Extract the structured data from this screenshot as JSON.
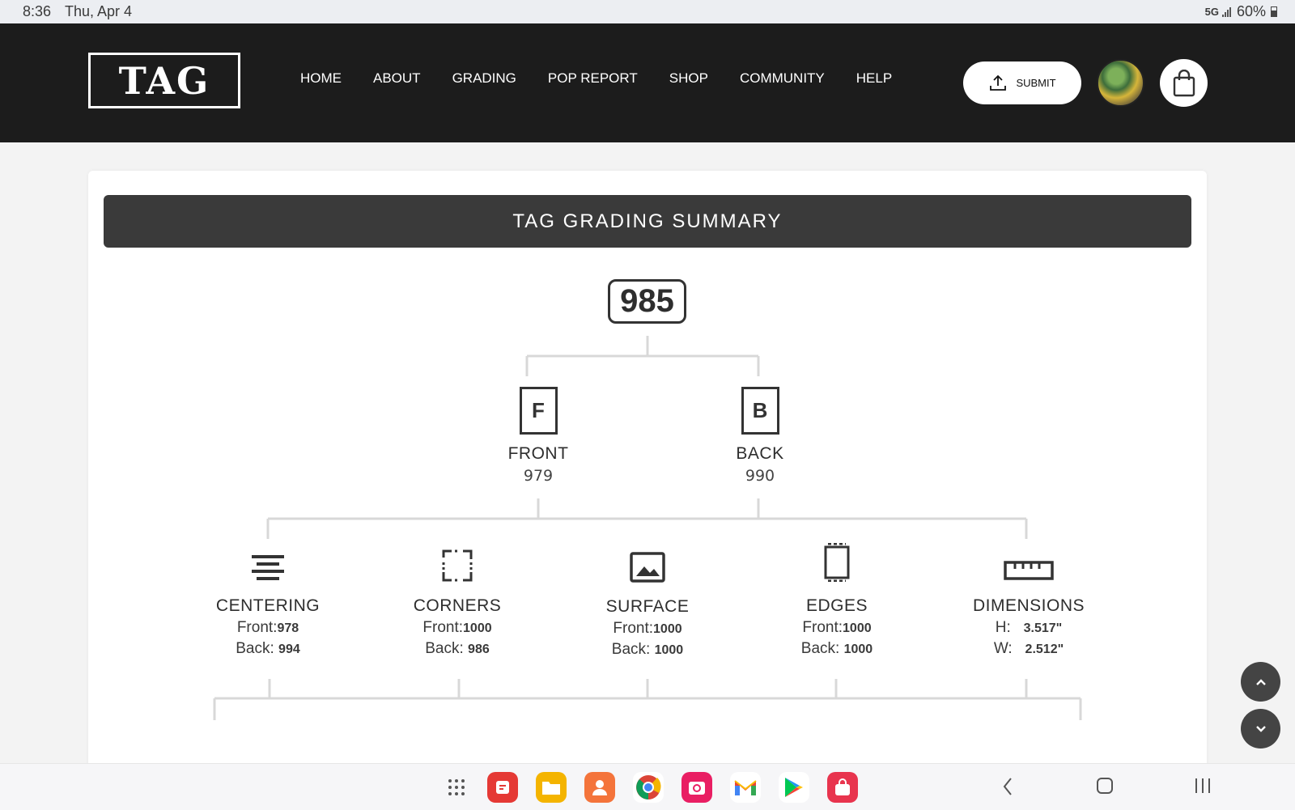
{
  "status": {
    "time": "8:36",
    "date": "Thu, Apr 4",
    "network": "5G",
    "battery": "60%"
  },
  "header": {
    "logo": "TAG",
    "nav": [
      "HOME",
      "ABOUT",
      "GRADING",
      "POP REPORT",
      "SHOP",
      "COMMUNITY",
      "HELP"
    ],
    "submit_label": "SUBMIT",
    "icons": {
      "submit": "upload-icon",
      "cart": "shopping-bag-icon"
    }
  },
  "summary": {
    "title": "TAG GRADING SUMMARY",
    "overall_score": "985",
    "front": {
      "letter": "F",
      "label": "FRONT",
      "value": "979"
    },
    "back": {
      "letter": "B",
      "label": "BACK",
      "value": "990"
    },
    "metrics": [
      {
        "label": "CENTERING",
        "row1_label": "Front:",
        "row1_value": "978",
        "row2_label": "Back:",
        "row2_value": "994",
        "icon": "centering-icon"
      },
      {
        "label": "CORNERS",
        "row1_label": "Front:",
        "row1_value": "1000",
        "row2_label": "Back:",
        "row2_value": "986",
        "icon": "corners-icon"
      },
      {
        "label": "SURFACE",
        "row1_label": "Front:",
        "row1_value": "1000",
        "row2_label": "Back:",
        "row2_value": "1000",
        "icon": "surface-icon"
      },
      {
        "label": "EDGES",
        "row1_label": "Front:",
        "row1_value": "1000",
        "row2_label": "Back:",
        "row2_value": "1000",
        "icon": "edges-icon"
      },
      {
        "label": "DIMENSIONS",
        "row1_label": "H:",
        "row1_value": "3.517\"",
        "row2_label": "W:",
        "row2_value": "2.512\"",
        "icon": "ruler-icon"
      }
    ]
  },
  "colors": {
    "header_bg": "#1c1c1c",
    "summary_bar": "#3a3a3a",
    "page_bg": "#f3f3f3",
    "lines": "#d8d8d8"
  },
  "dock": {
    "apps": [
      "app-drawer-icon",
      "notes-icon",
      "files-icon",
      "contacts-icon",
      "chrome-icon",
      "camera-icon",
      "gmail-icon",
      "play-store-icon",
      "galaxy-store-icon"
    ],
    "nav": [
      "back-icon",
      "home-icon",
      "recents-icon"
    ]
  }
}
